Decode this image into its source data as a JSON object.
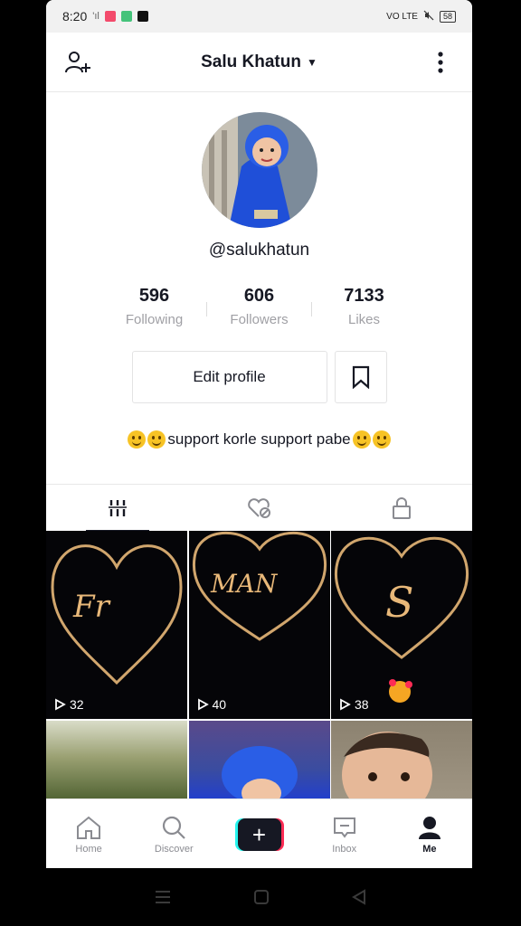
{
  "status_bar": {
    "time": "8:20",
    "signal": "'ıl",
    "network": "VO LTE",
    "battery": "58"
  },
  "header": {
    "title": "Salu Khatun"
  },
  "profile": {
    "username": "@salukhatun",
    "stats": [
      {
        "value": "596",
        "label": "Following"
      },
      {
        "value": "606",
        "label": "Followers"
      },
      {
        "value": "7133",
        "label": "Likes"
      }
    ],
    "edit_label": "Edit profile",
    "bio_text": "support korle support pabe"
  },
  "videos": [
    {
      "views": "32",
      "art_text": "Fr"
    },
    {
      "views": "40",
      "art_text": "MAN"
    },
    {
      "views": "38",
      "art_text": "S"
    }
  ],
  "nav": {
    "home": "Home",
    "discover": "Discover",
    "inbox": "Inbox",
    "me": "Me"
  },
  "colors": {
    "accent_red": "#fe2c55",
    "accent_cyan": "#25f4ee",
    "text": "#161823",
    "muted": "#a0a0a5"
  }
}
